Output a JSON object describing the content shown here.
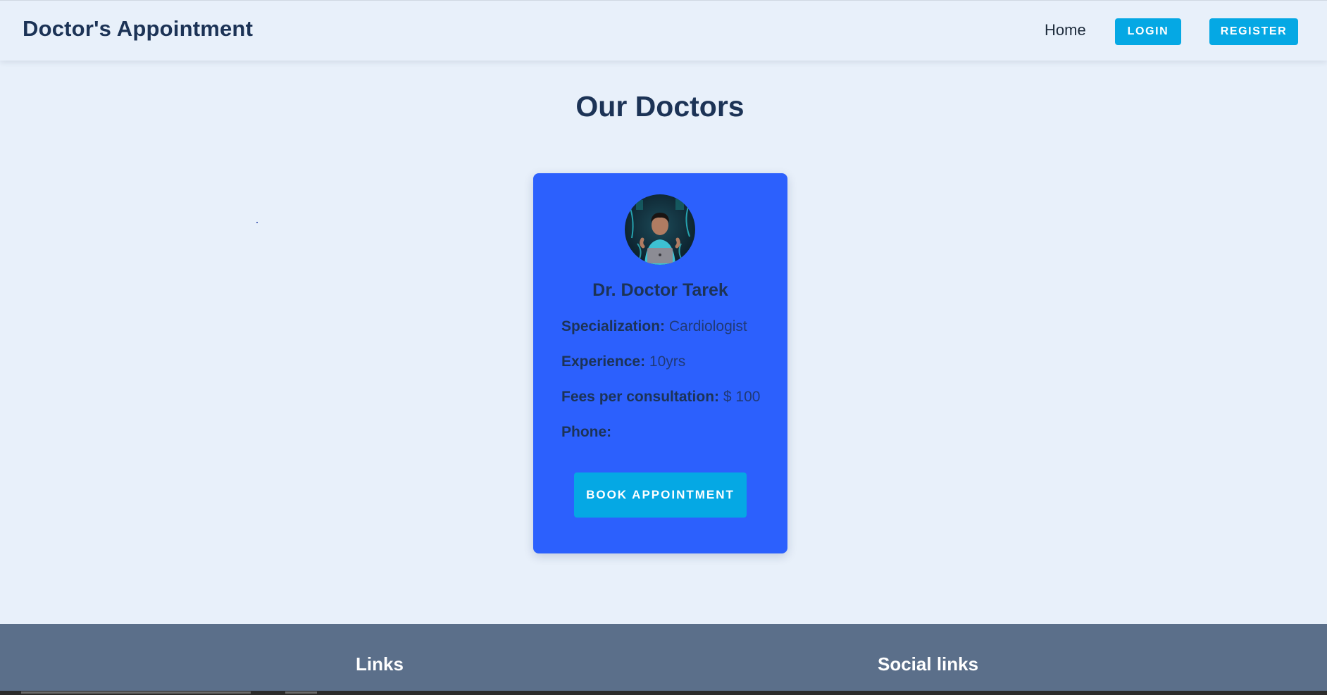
{
  "header": {
    "brand": "Doctor's Appointment",
    "nav": {
      "home": "Home",
      "login": "LOGIN",
      "register": "REGISTER"
    }
  },
  "main": {
    "title": "Our Doctors",
    "doctors": [
      {
        "name": "Dr. Doctor Tarek",
        "specialization_label": "Specialization:",
        "specialization": "Cardiologist",
        "experience_label": "Experience:",
        "experience": "10yrs",
        "fees_label": "Fees per consultation:",
        "fees": "$ 100",
        "phone_label": "Phone:",
        "phone": "",
        "book_label": "BOOK APPOINTMENT"
      }
    ]
  },
  "footer": {
    "links_heading": "Links",
    "social_heading": "Social links"
  },
  "colors": {
    "background": "#e8f0fa",
    "brand_text": "#1c3356",
    "accent_button": "#05a8e4",
    "card": "#2c60fd",
    "footer": "#5b6f8a"
  }
}
